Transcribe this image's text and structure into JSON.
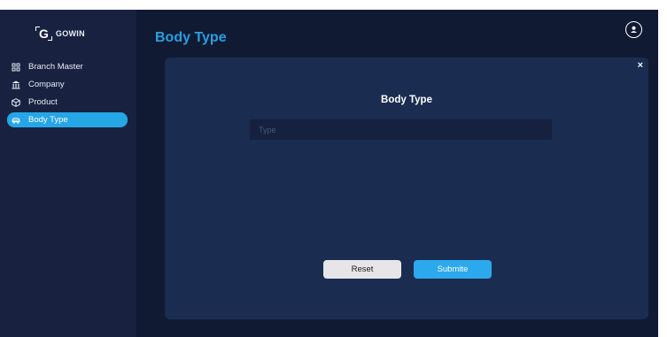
{
  "app": {
    "logo_mark": "G",
    "logo_text": "GOWIN"
  },
  "sidebar": {
    "items": [
      {
        "label": "Branch Master",
        "icon": "branch-icon",
        "active": false
      },
      {
        "label": "Company",
        "icon": "bank-icon",
        "active": false
      },
      {
        "label": "Product",
        "icon": "cube-icon",
        "active": false
      },
      {
        "label": "Body Type",
        "icon": "car-icon",
        "active": true
      }
    ]
  },
  "header": {
    "title": "Body Type",
    "profile_icon": "user-icon"
  },
  "modal": {
    "close_label": "×",
    "title": "Body Type",
    "type_field": {
      "placeholder": "Type",
      "value": ""
    },
    "reset_label": "Reset",
    "submit_label": "Submite"
  },
  "colors": {
    "background": "#111a33",
    "sidebar": "#182240",
    "modal": "#1a2c4f",
    "accent": "#25a6e6",
    "title": "#2a9fe0"
  }
}
